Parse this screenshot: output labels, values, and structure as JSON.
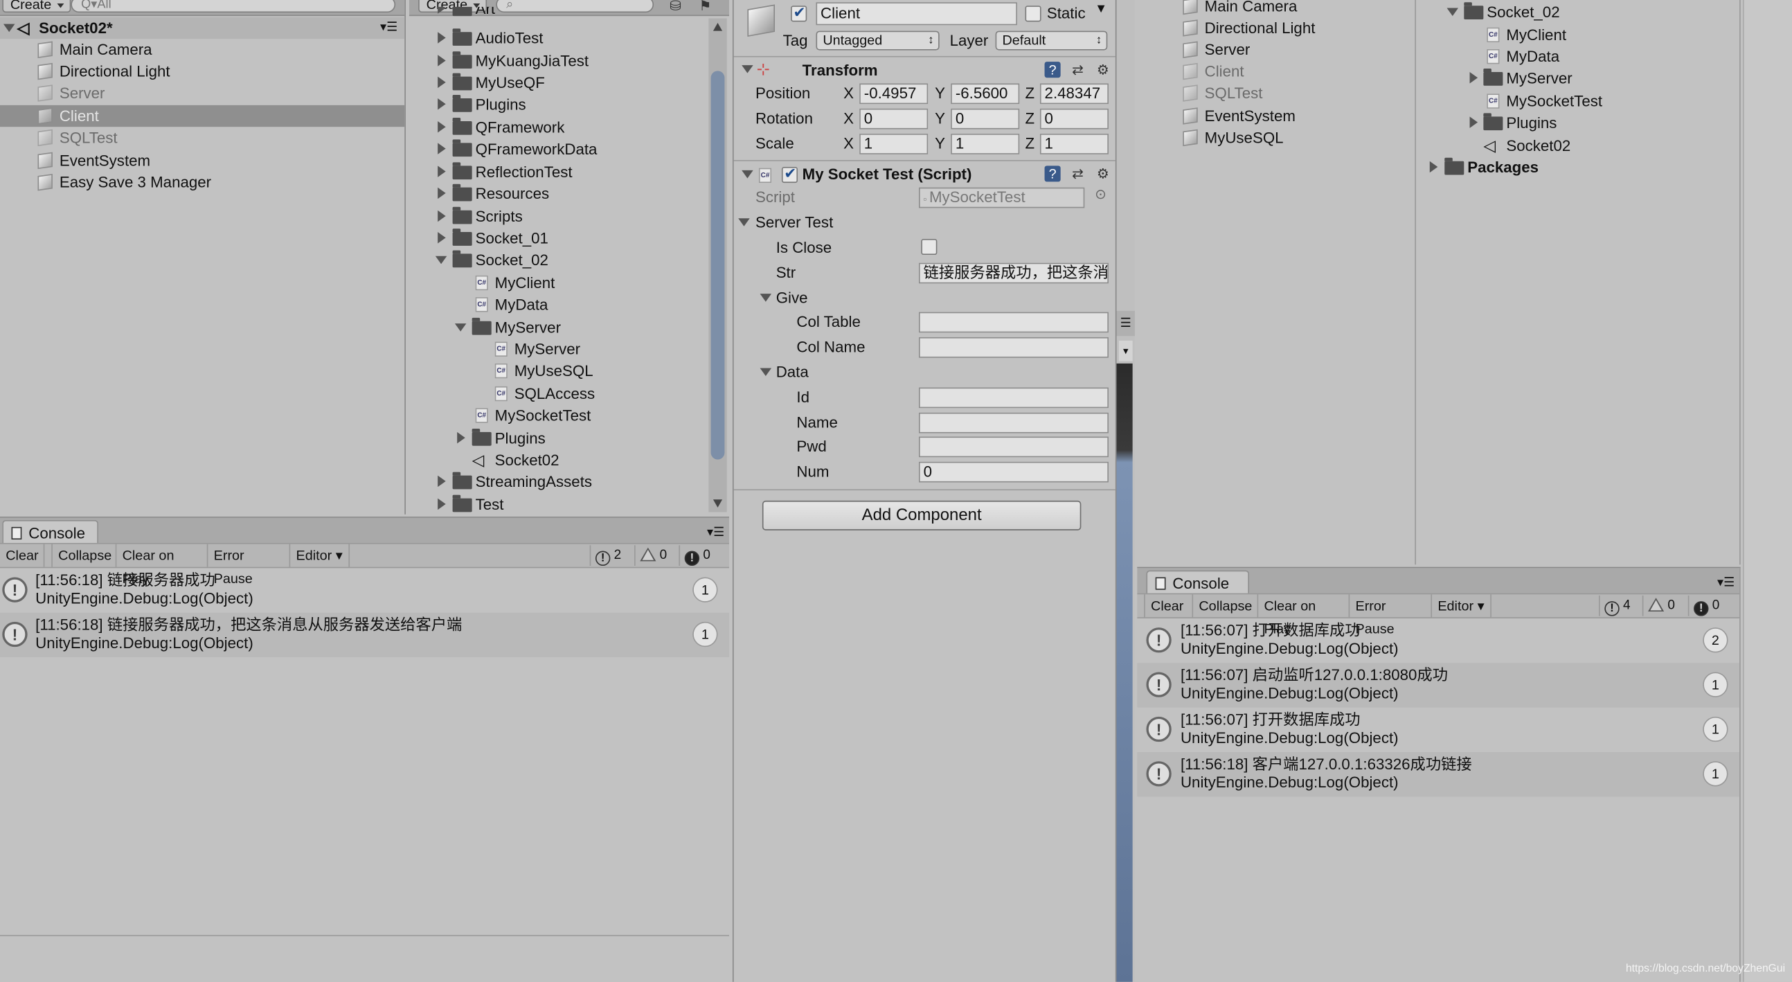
{
  "hierarchy": {
    "create_label": "Create",
    "search_placeholder": "Q▾All",
    "scene_name": "Socket02*",
    "items": [
      "Main Camera",
      "Directional Light",
      "Server",
      "Client",
      "SQLTest",
      "EventSystem",
      "Easy Save 3 Manager"
    ],
    "selected": "Client"
  },
  "project": {
    "create_label": "Create",
    "items": [
      "Art",
      "AudioTest",
      "MyKuangJiaTest",
      "MyUseQF",
      "Plugins",
      "QFramework",
      "QFrameworkData",
      "ReflectionTest",
      "Resources",
      "Scripts",
      "Socket_01",
      "Socket_02",
      "MyClient",
      "MyData",
      "MyServer",
      "MyServer",
      "MyUseSQL",
      "SQLAccess",
      "MySocketTest",
      "Plugins",
      "Socket02",
      "StreamingAssets",
      "Test"
    ]
  },
  "console_left": {
    "tab": "Console",
    "buttons": [
      "Clear",
      "Collapse",
      "Clear on Play",
      "Error Pause",
      "Editor"
    ],
    "counts": {
      "info": "2",
      "warn": "0",
      "error": "0"
    },
    "logs": [
      {
        "line1": "[11:56:18] 链接服务器成功",
        "line2": "UnityEngine.Debug:Log(Object)",
        "count": "1"
      },
      {
        "line1": "[11:56:18] 链接服务器成功，把这条消息从服务器发送给客户端",
        "line2": "UnityEngine.Debug:Log(Object)",
        "count": "1"
      }
    ]
  },
  "inspector": {
    "object_name": "Client",
    "static_label": "Static",
    "tag_label": "Tag",
    "tag_value": "Untagged",
    "layer_label": "Layer",
    "layer_value": "Default",
    "transform_title": "Transform",
    "position_label": "Position",
    "rotation_label": "Rotation",
    "scale_label": "Scale",
    "axis": [
      "X",
      "Y",
      "Z"
    ],
    "position": [
      "-0.4957",
      "-6.5600",
      "2.48347"
    ],
    "rotation": [
      "0",
      "0",
      "0"
    ],
    "scale": [
      "1",
      "1",
      "1"
    ],
    "script_component_title": "My Socket Test (Script)",
    "script_label": "Script",
    "script_value": "MySocketTest",
    "server_test_label": "Server Test",
    "is_close_label": "Is Close",
    "str_label": "Str",
    "str_value": "链接服务器成功，把这条消",
    "give_label": "Give",
    "col_table_label": "Col Table",
    "col_name_label": "Col Name",
    "data_label": "Data",
    "id_label": "Id",
    "name_label": "Name",
    "pwd_label": "Pwd",
    "num_label": "Num",
    "num_value": "0",
    "add_component": "Add Component"
  },
  "hierarchy_right": {
    "items": [
      "Main Camera",
      "Directional Light",
      "Server",
      "Client",
      "SQLTest",
      "EventSystem",
      "MyUseSQL"
    ]
  },
  "project_right": {
    "items": [
      "Socket_02",
      "MyClient",
      "MyData",
      "MyServer",
      "MySocketTest",
      "Plugins",
      "Socket02",
      "Packages"
    ]
  },
  "console_right": {
    "tab": "Console",
    "buttons": [
      "Clear",
      "Collapse",
      "Clear on Play",
      "Error Pause",
      "Editor"
    ],
    "counts": {
      "info": "4",
      "warn": "0",
      "error": "0"
    },
    "logs": [
      {
        "line1": "[11:56:07] 打开数据库成功",
        "line2": "UnityEngine.Debug:Log(Object)",
        "count": "2"
      },
      {
        "line1": "[11:56:07] 启动监听127.0.0.1:8080成功",
        "line2": "UnityEngine.Debug:Log(Object)",
        "count": "1"
      },
      {
        "line1": "[11:56:07] 打开数据库成功",
        "line2": "UnityEngine.Debug:Log(Object)",
        "count": "1"
      },
      {
        "line1": "[11:56:18] 客户端127.0.0.1:63326成功链接",
        "line2": "UnityEngine.Debug:Log(Object)",
        "count": "1"
      }
    ]
  },
  "watermark": "https://blog.csdn.net/boyZhenGui"
}
